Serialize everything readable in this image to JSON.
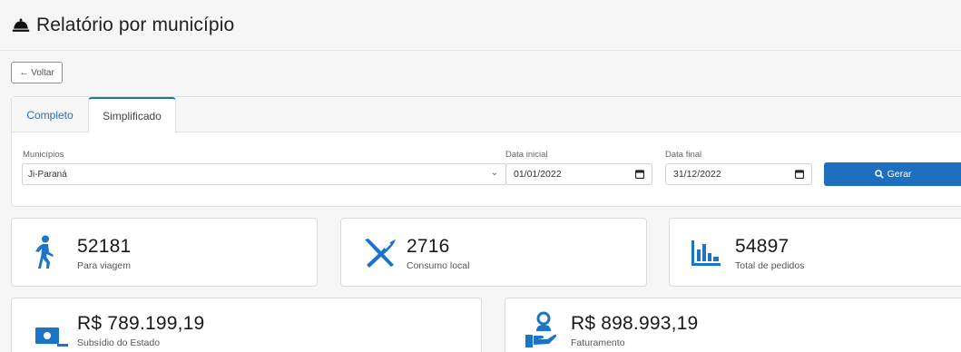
{
  "header": {
    "title": "Relatório por município",
    "icon": "bell-icon"
  },
  "back_button": {
    "label": "Voltar",
    "icon": "arrow-left-icon"
  },
  "tabs": [
    {
      "label": "Completo",
      "active": false
    },
    {
      "label": "Simplificado",
      "active": true
    }
  ],
  "filters": {
    "municipio_label": "Municípios",
    "municipio_value": "Ji-Paraná",
    "data_inicial_label": "Data inicial",
    "data_inicial_value": "01/01/2022",
    "data_final_label": "Data final",
    "data_final_value": "31/12/2022",
    "generate_label": "Gerar"
  },
  "stats": [
    {
      "value": "52181",
      "caption": "Para viagem",
      "icon": "walking-person-icon"
    },
    {
      "value": "2716",
      "caption": "Consumo local",
      "icon": "utensils-icon"
    },
    {
      "value": "54897",
      "caption": "Total de pedidos",
      "icon": "bar-chart-icon"
    },
    {
      "value": "R$ 789.199,19",
      "caption": "Subsídio do Estado",
      "icon": "money-bill-icon"
    },
    {
      "value": "R$ 898.993,19",
      "caption": "Faturamento",
      "icon": "hand-holding-user-icon"
    }
  ],
  "colors": {
    "primary": "#1f6fc1",
    "icon_blue": "#1b74c8"
  }
}
